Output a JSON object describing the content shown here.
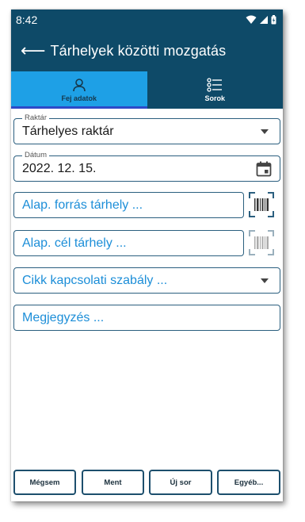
{
  "status": {
    "time": "8:42"
  },
  "appbar": {
    "back_icon": "arrow-left-icon",
    "title": "Tárhelyek közötti mozgatás"
  },
  "tabs": [
    {
      "label": "Fej adatok",
      "icon": "person-icon",
      "active": true
    },
    {
      "label": "Sorok",
      "icon": "list-icon",
      "active": false
    }
  ],
  "form": {
    "warehouse": {
      "label": "Raktár",
      "value": "Tárhelyes raktár"
    },
    "date": {
      "label": "Dátum",
      "value": "2022. 12. 15."
    },
    "source_bin": {
      "placeholder": "Alap. forrás tárhely ..."
    },
    "target_bin": {
      "placeholder": "Alap. cél tárhely ..."
    },
    "item_rule": {
      "placeholder": "Cikk kapcsolati szabály ..."
    },
    "note": {
      "placeholder": "Megjegyzés ..."
    }
  },
  "buttons": {
    "cancel": "Mégsem",
    "save": "Ment",
    "new_row": "Új sor",
    "other": "Egyéb..."
  },
  "colors": {
    "header": "#0e4a68",
    "active_tab": "#1ea0e6",
    "field_border": "#2b5f7f",
    "placeholder": "#1c8ed8"
  }
}
